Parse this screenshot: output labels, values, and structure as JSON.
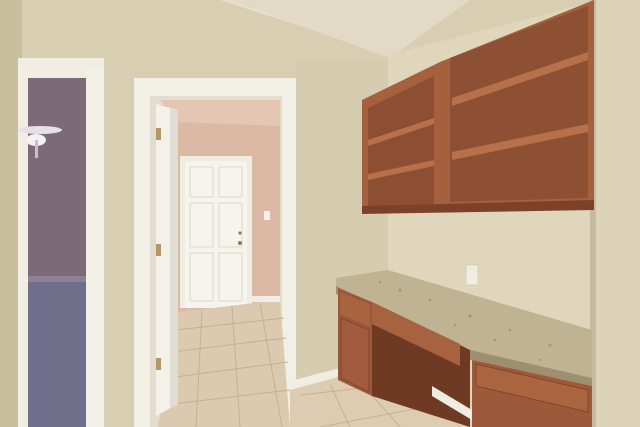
{
  "scene": {
    "description_free": true,
    "colors": {
      "wall": "#d8ceb2",
      "wall_shadow": "#b8ae94",
      "ceiling": "#e4dcc8",
      "trim": "#f2efe6",
      "door": "#f4f2ea",
      "hall_wall": "#dcb9a4",
      "bedroom_wall": "#7d6a78",
      "bedroom_floor": "#6e6e8a",
      "tile": "#dccab0",
      "tile_grout": "#c8b597",
      "cabinet": "#9c5a3c",
      "cabinet_dark": "#7a4028",
      "cabinet_interior": "#8a4e34",
      "granite": "#bdb192",
      "outlet": "#f0ece0"
    },
    "icons": [
      "ceiling-fan-icon",
      "door-hinge-icon",
      "door-knob-icon",
      "light-switch-icon",
      "electrical-outlet-icon"
    ]
  }
}
